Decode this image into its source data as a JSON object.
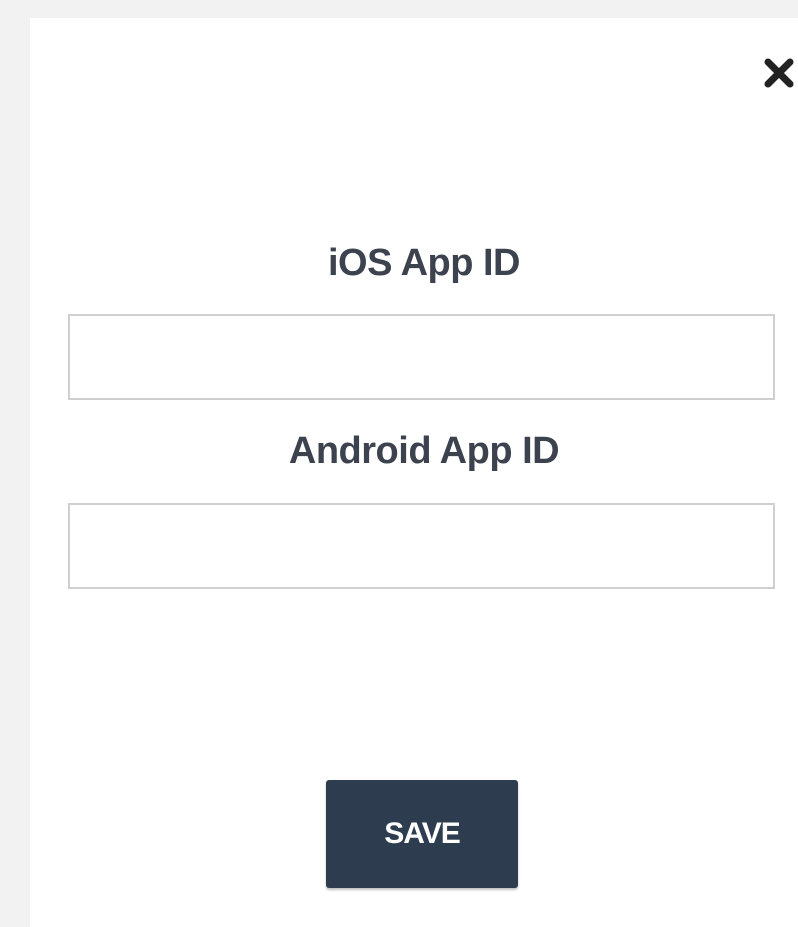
{
  "dialog": {
    "close_icon": "close-icon",
    "ios_field": {
      "label": "iOS App ID",
      "value": "",
      "placeholder": ""
    },
    "android_field": {
      "label": "Android App ID",
      "value": "",
      "placeholder": ""
    },
    "save_label": "SAVE"
  },
  "colors": {
    "backdrop": "#f2f2f3",
    "dialog_bg": "#ffffff",
    "label_text": "#3c434e",
    "input_border": "#cfcfcf",
    "button_bg": "#2d3d4f",
    "button_text": "#ffffff",
    "close_icon": "#222222"
  }
}
